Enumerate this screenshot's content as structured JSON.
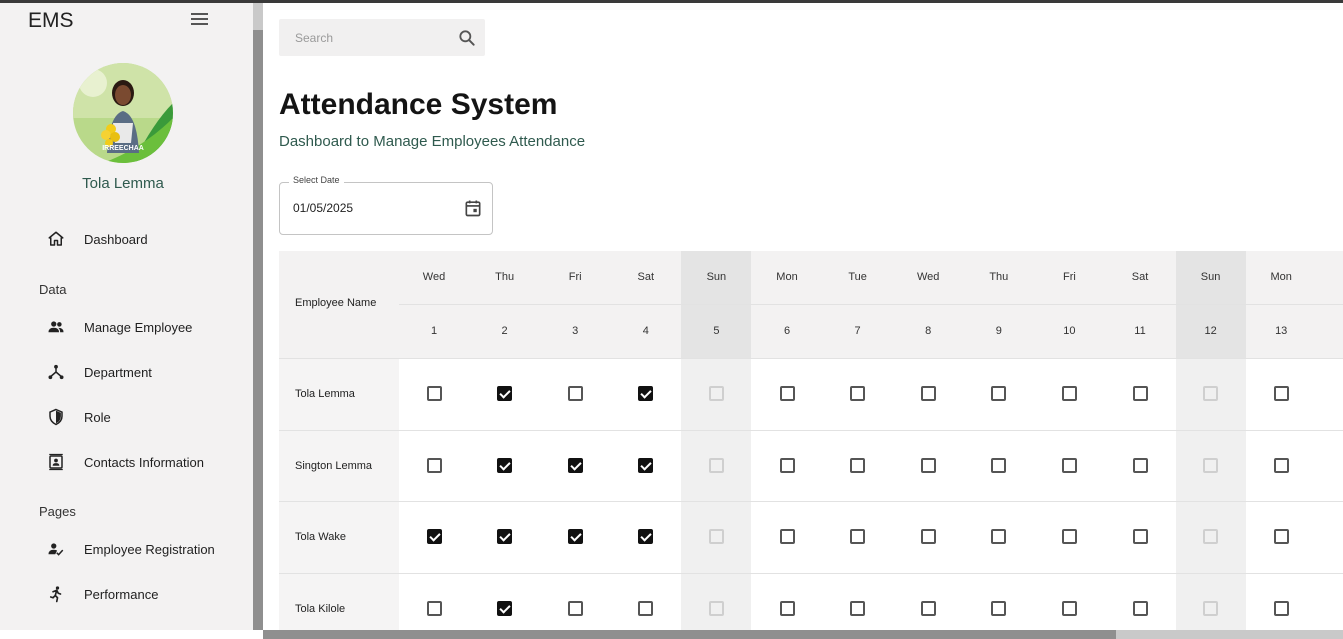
{
  "app": {
    "brand": "EMS"
  },
  "user": {
    "name": "Tola Lemma",
    "avatar_caption": "IRREECHAA"
  },
  "nav": {
    "dashboard": "Dashboard",
    "section_data": "Data",
    "manage_employee": "Manage Employee",
    "department": "Department",
    "role": "Role",
    "contacts": "Contacts Information",
    "section_pages": "Pages",
    "employee_registration": "Employee Registration",
    "performance": "Performance"
  },
  "search": {
    "placeholder": "Search",
    "value": ""
  },
  "page": {
    "title": "Attendance System",
    "subtitle": "Dashboard to Manage Employees Attendance"
  },
  "date_picker": {
    "label": "Select Date",
    "value": "01/05/2025"
  },
  "table": {
    "name_header": "Employee Name",
    "days": [
      {
        "dow": "Wed",
        "day": "1",
        "weekend": false
      },
      {
        "dow": "Thu",
        "day": "2",
        "weekend": false
      },
      {
        "dow": "Fri",
        "day": "3",
        "weekend": false
      },
      {
        "dow": "Sat",
        "day": "4",
        "weekend": false
      },
      {
        "dow": "Sun",
        "day": "5",
        "weekend": true
      },
      {
        "dow": "Mon",
        "day": "6",
        "weekend": false
      },
      {
        "dow": "Tue",
        "day": "7",
        "weekend": false
      },
      {
        "dow": "Wed",
        "day": "8",
        "weekend": false
      },
      {
        "dow": "Thu",
        "day": "9",
        "weekend": false
      },
      {
        "dow": "Fri",
        "day": "10",
        "weekend": false
      },
      {
        "dow": "Sat",
        "day": "11",
        "weekend": false
      },
      {
        "dow": "Sun",
        "day": "12",
        "weekend": true
      },
      {
        "dow": "Mon",
        "day": "13",
        "weekend": false
      }
    ],
    "employees": [
      {
        "name": "Tola Lemma",
        "attendance": [
          false,
          true,
          false,
          true,
          false,
          false,
          false,
          false,
          false,
          false,
          false,
          false,
          false
        ]
      },
      {
        "name": "Sington Lemma",
        "attendance": [
          false,
          true,
          true,
          true,
          false,
          false,
          false,
          false,
          false,
          false,
          false,
          false,
          false
        ]
      },
      {
        "name": "Tola Wake",
        "attendance": [
          true,
          true,
          true,
          true,
          false,
          false,
          false,
          false,
          false,
          false,
          false,
          false,
          false
        ]
      },
      {
        "name": "Tola Kilole",
        "attendance": [
          false,
          true,
          false,
          false,
          false,
          false,
          false,
          false,
          false,
          false,
          false,
          false,
          false
        ]
      }
    ]
  }
}
